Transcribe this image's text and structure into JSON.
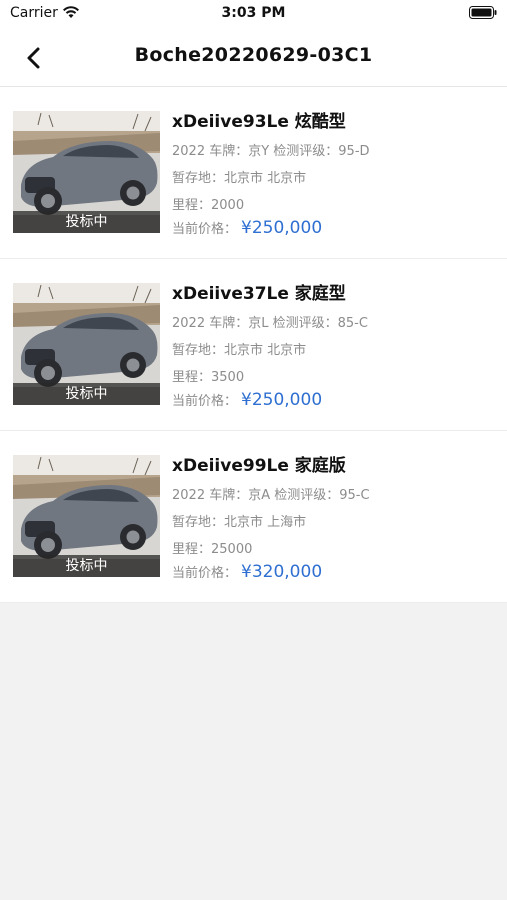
{
  "status": {
    "carrier": "Carrier",
    "time": "3:03 PM"
  },
  "nav": {
    "title": "Boche20220629-03C1"
  },
  "labels": {
    "mileage": "里程：",
    "storage": "暂存地：",
    "price": "当前价格："
  },
  "colors": {
    "price": "#2f6fd1",
    "tag_bg": "#3a3a3a"
  },
  "items": [
    {
      "title": "xDeiive93Le 炫酷型",
      "spec": "2022 车牌：京Y 检测评级：95-D",
      "location": "北京市 北京市",
      "mileage": "2000",
      "price": "¥250,000",
      "tag": "投标中"
    },
    {
      "title": "xDeiive37Le 家庭型",
      "spec": "2022 车牌：京L 检测评级：85-C",
      "location": "北京市 北京市",
      "mileage": "3500",
      "price": "¥250,000",
      "tag": "投标中"
    },
    {
      "title": "xDeiive99Le 家庭版",
      "spec": "2022 车牌：京A 检测评级：95-C",
      "location": "北京市 上海市",
      "mileage": "25000",
      "price": "¥320,000",
      "tag": "投标中"
    }
  ]
}
